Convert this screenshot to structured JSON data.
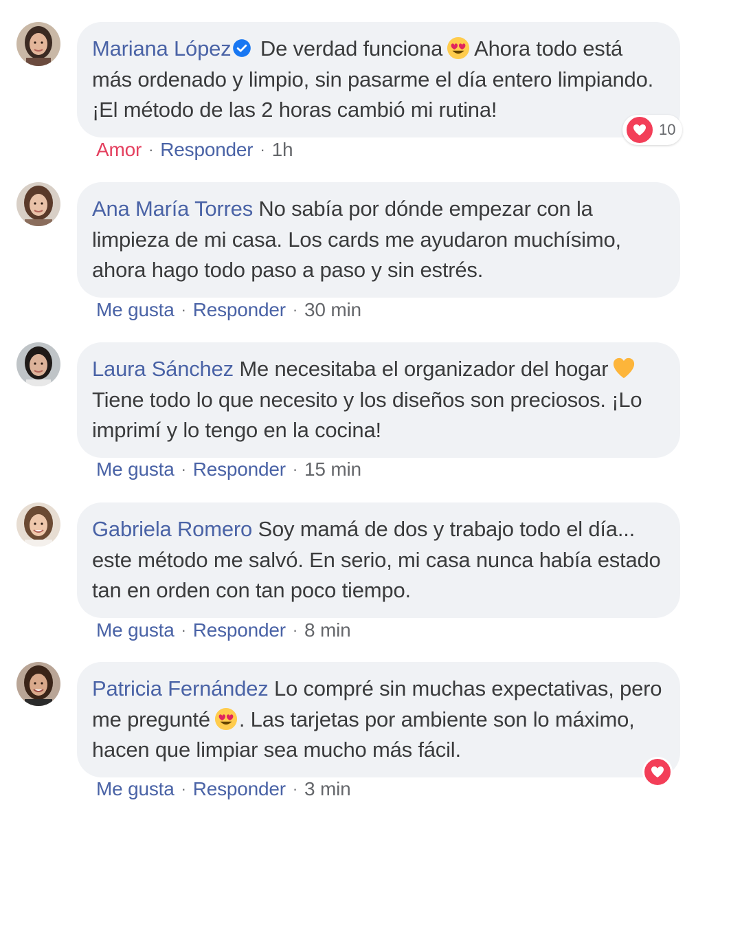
{
  "colors": {
    "name": "#4a63a6",
    "text": "#3a3b3c",
    "muted": "#65676b",
    "love": "#e4405f",
    "bubble": "#f0f2f5"
  },
  "comments": [
    {
      "author": "Mariana López",
      "verified": true,
      "text_parts": [
        "De verdad funciona",
        "Ahora todo está más ordenado y limpio, sin pasarme el día entero limpiando. ¡El método de las 2 horas cambió mi rutina!"
      ],
      "emoji": "heart-eyes-emoji",
      "reaction_label": "Amor",
      "reply_label": "Responder",
      "time": "1h",
      "reaction_count": "10"
    },
    {
      "author": "Ana María Torres",
      "text": "No sabía por dónde empezar con la limpieza de mi casa. Los cards me ayudaron muchísimo, ahora hago todo paso a paso y sin estrés.",
      "reaction_label": "Me gusta",
      "reply_label": "Responder",
      "time": "30 min"
    },
    {
      "author": "Laura Sánchez",
      "text_parts": [
        "Me necesitaba el organizador del hogar",
        "Tiene todo lo que necesito y los diseños son preciosos. ¡Lo imprimí y lo tengo en la cocina!"
      ],
      "emoji": "yellow-heart-emoji",
      "reaction_label": "Me gusta",
      "reply_label": "Responder",
      "time": "15 min"
    },
    {
      "author": "Gabriela Romero",
      "text": "Soy mamá de dos y trabajo todo el día... este método me salvó. En serio, mi casa nunca había estado tan en orden con tan poco tiempo.",
      "reaction_label": "Me gusta",
      "reply_label": "Responder",
      "time": "8 min"
    },
    {
      "author": "Patricia Fernández",
      "text_parts": [
        "Lo compré sin muchas expectativas, pero me pregunté",
        ". Las tarjetas por ambiente son lo máximo, hacen que limpiar sea mucho más fácil."
      ],
      "emoji": "heart-eyes-emoji",
      "reaction_label": "Me gusta",
      "reply_label": "Responder",
      "time": "3 min"
    }
  ]
}
